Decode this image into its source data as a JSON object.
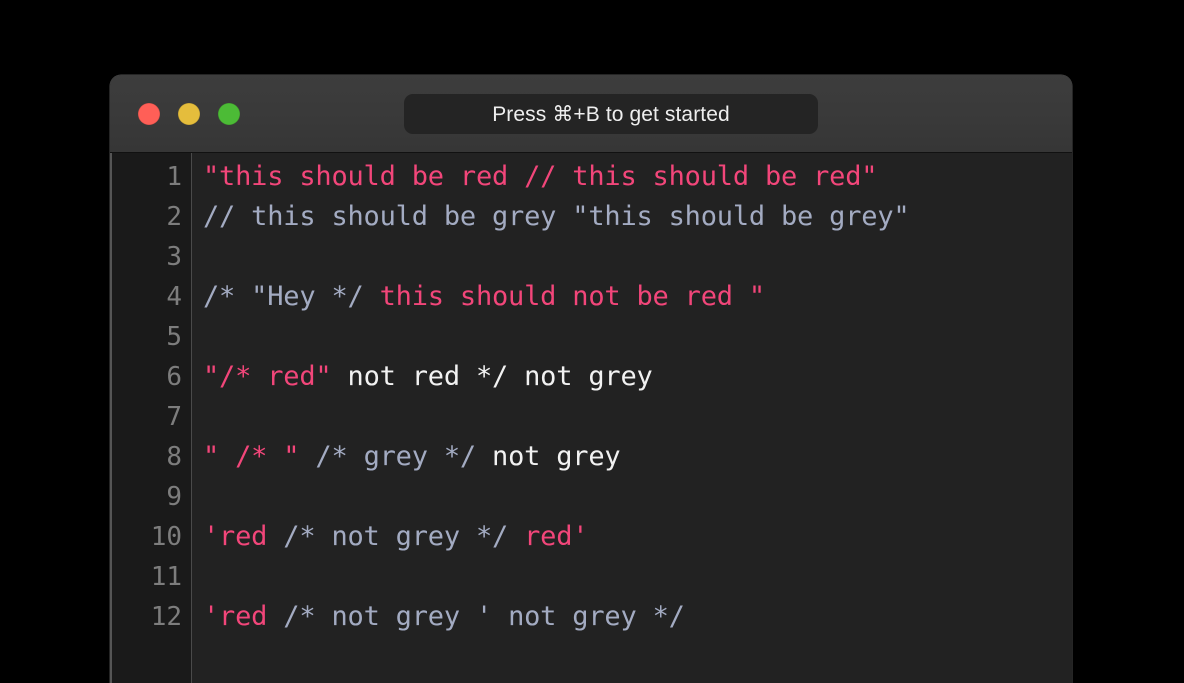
{
  "window": {
    "titlebar": {
      "title": "Press ⌘+B to get started",
      "controls": [
        {
          "name": "close",
          "color": "#ff5f57"
        },
        {
          "name": "minimize",
          "color": "#e5bd3c"
        },
        {
          "name": "maximize",
          "color": "#4cbb36"
        }
      ]
    }
  },
  "editor": {
    "colors": {
      "background": "#222222",
      "gutter_background": "#1a1a1a",
      "line_number": "#7d7d7d",
      "string": "#f2467a",
      "comment": "#a3abc2",
      "plain": "#f2f2f2"
    },
    "line_numbers": [
      "1",
      "2",
      "3",
      "4",
      "5",
      "6",
      "7",
      "8",
      "9",
      "10",
      "11",
      "12"
    ],
    "lines": [
      {
        "number": "1",
        "text": "\"this should be red // this should be red\"",
        "tokens": [
          {
            "kind": "string",
            "text": "\"this should be red // this should be red\""
          }
        ]
      },
      {
        "number": "2",
        "text": "// this should be grey \"this should be grey\"",
        "tokens": [
          {
            "kind": "comment",
            "text": "// this should be grey \"this should be grey\""
          }
        ]
      },
      {
        "number": "3",
        "text": "",
        "tokens": []
      },
      {
        "number": "4",
        "text": "/* \"Hey */ this should not be red \"",
        "tokens": [
          {
            "kind": "comment",
            "text": "/* \"Hey */"
          },
          {
            "kind": "string",
            "text": " this should not be red \""
          }
        ]
      },
      {
        "number": "5",
        "text": "",
        "tokens": []
      },
      {
        "number": "6",
        "text": "\"/* red\" not red */ not grey",
        "tokens": [
          {
            "kind": "string",
            "text": "\"/* red\""
          },
          {
            "kind": "plain",
            "text": " not red */ not grey"
          }
        ]
      },
      {
        "number": "7",
        "text": "",
        "tokens": []
      },
      {
        "number": "8",
        "text": "\" /* \" /* grey */ not grey",
        "tokens": [
          {
            "kind": "string",
            "text": "\" /* \""
          },
          {
            "kind": "comment",
            "text": " /* grey */"
          },
          {
            "kind": "plain",
            "text": " not grey"
          }
        ]
      },
      {
        "number": "9",
        "text": "",
        "tokens": []
      },
      {
        "number": "10",
        "text": "'red /* not grey */ red'",
        "tokens": [
          {
            "kind": "string",
            "text": "'red "
          },
          {
            "kind": "comment",
            "text": "/* not grey */"
          },
          {
            "kind": "string",
            "text": " red'"
          }
        ]
      },
      {
        "number": "11",
        "text": "",
        "tokens": []
      },
      {
        "number": "12",
        "text": "'red /* not grey ' not grey */",
        "tokens": [
          {
            "kind": "string",
            "text": "'red"
          },
          {
            "kind": "comment",
            "text": " /* not grey ' not grey */"
          }
        ]
      }
    ]
  }
}
